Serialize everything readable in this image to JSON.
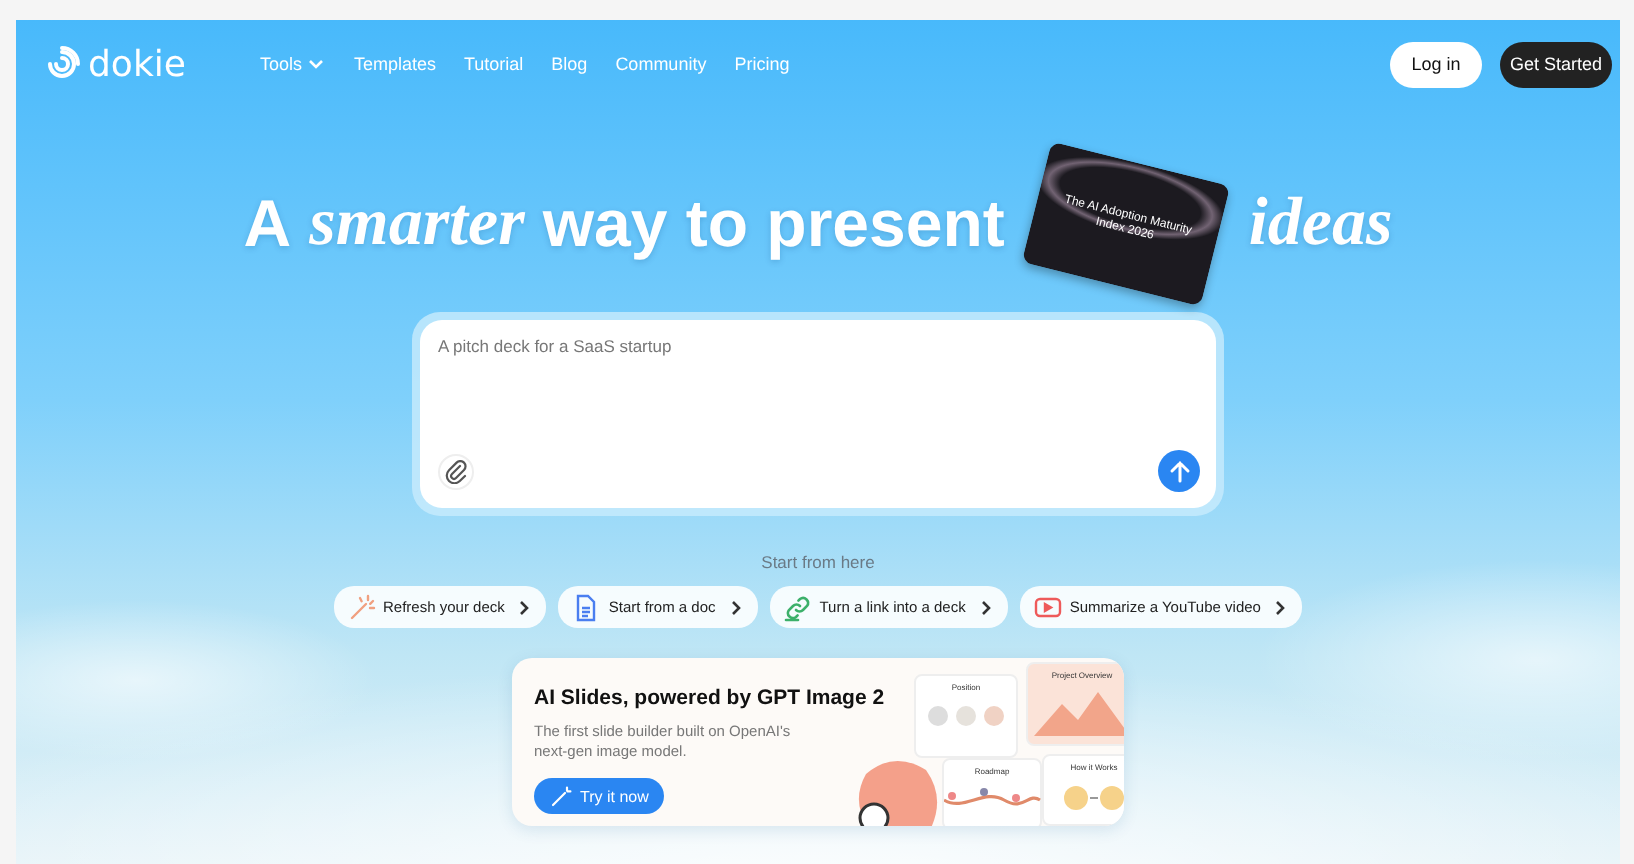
{
  "nav": {
    "logo": "dokie",
    "links": [
      {
        "label": "Tools",
        "dropdown": true
      },
      {
        "label": "Templates",
        "dropdown": false
      },
      {
        "label": "Tutorial",
        "dropdown": false
      },
      {
        "label": "Blog",
        "dropdown": false
      },
      {
        "label": "Community",
        "dropdown": false
      },
      {
        "label": "Pricing",
        "dropdown": false
      }
    ],
    "login": "Log in",
    "cta": "Get Started"
  },
  "headline": [
    {
      "kind": "plain",
      "text": "A"
    },
    {
      "kind": "italic",
      "text": "smarter"
    },
    {
      "kind": "plain",
      "text": "way to present"
    },
    {
      "kind": "slide",
      "text": "The AI Adoption Maturity Index 2026"
    },
    {
      "kind": "italic",
      "text": "ideas"
    }
  ],
  "prompt": {
    "placeholder": "A pitch deck for a SaaS startup"
  },
  "start_label": "Start from here",
  "chips": [
    {
      "kind": "wand",
      "label": "Refresh your deck"
    },
    {
      "kind": "doc",
      "label": "Start from a doc"
    },
    {
      "kind": "link",
      "label": "Turn a link into a deck"
    },
    {
      "kind": "video",
      "label": "Summarize a YouTube video"
    }
  ],
  "promo": {
    "title": "AI Slides, powered by GPT Image 2",
    "description": "The first slide builder built on OpenAI's next-gen image model.",
    "button": "Try it now",
    "slides": [
      {
        "kind": "icons",
        "title": "Position"
      },
      {
        "kind": "cover",
        "title": "Project Overview"
      },
      {
        "kind": "timeline",
        "title": "Roadmap"
      },
      {
        "kind": "flow",
        "title": "How it Works"
      }
    ]
  }
}
